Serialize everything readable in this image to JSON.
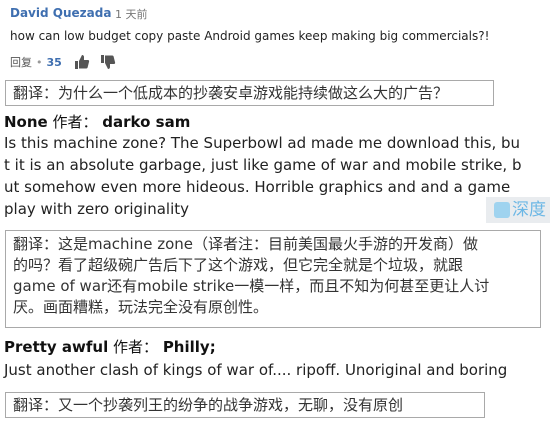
{
  "youtube_comment": {
    "author": "David Quezada",
    "time": "1 天前",
    "text": "how can low budget copy paste Android games keep making big commercials?!",
    "reply_label": "回复",
    "like_count": "35",
    "icons": [
      "thumbs-up-icon",
      "thumbs-down-icon"
    ]
  },
  "translation_1": "翻译：为什么一个低成本的抄袭安卓游戏能持续做这么大的广告？",
  "comment_2": {
    "username": "None",
    "author_label": "作者：",
    "author": "darko sam",
    "lines": [
      "Is this machine zone? The Superbowl ad made me download this, bu",
      "t it is an absolute garbage, just like game of war and mobile strike, b",
      "ut somehow even more hideous. Horrible graphics and and a game",
      "play with zero originality"
    ]
  },
  "translation_2": {
    "lines": [
      "翻译：这是machine zone（译者注：目前美国最火手游的开发商）做",
      "的吗？看了超级碗广告后下了这个游戏，但它完全就是个垃圾，就跟",
      "game of war还有mobile strike一模一样，而且不知为何甚至更让人讨",
      "厌。画面糟糕，玩法完全没有原创性。"
    ]
  },
  "comment_3": {
    "username": "Pretty awful",
    "author_label": "作者：",
    "author": "Philly;",
    "text": "Just another clash of kings of war of.... ripoff. Unoriginal and boring"
  },
  "translation_3": "翻译：又一个抄袭列王的纷争的战争游戏，无聊，没有原创",
  "watermark": "深度"
}
